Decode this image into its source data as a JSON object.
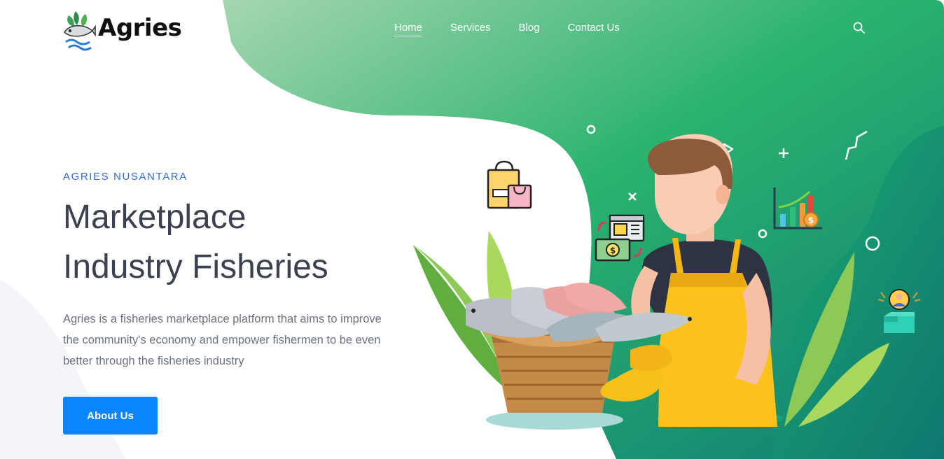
{
  "brand": {
    "name": "Agries",
    "logo_icon": "fish-leaf-logo-icon"
  },
  "nav": {
    "items": [
      {
        "label": "Home",
        "active": true
      },
      {
        "label": "Services",
        "active": false
      },
      {
        "label": "Blog",
        "active": false
      },
      {
        "label": "Contact Us",
        "active": false
      }
    ],
    "search_icon": "search-icon"
  },
  "hero": {
    "eyebrow": "AGRIES NUSANTARA",
    "title_line1": "Marketplace",
    "title_line2": "Industry Fisheries",
    "description": "Agries is a fisheries marketplace platform that aims to improve the community's economy and empower fishermen to be even better through the fisheries industry",
    "cta_label": "About Us"
  },
  "colors": {
    "accent": "#0a84ff",
    "eyebrow": "#2f6ddb",
    "green_light": "#8fd0a6",
    "green_mid": "#1fae6a",
    "green_dark": "#0e7f73"
  },
  "illustration_icons": [
    "shopping-bag-icon",
    "payment-exchange-icon",
    "growth-chart-icon",
    "delivery-box-icon",
    "fisherman-illustration",
    "fish-basket-illustration"
  ]
}
